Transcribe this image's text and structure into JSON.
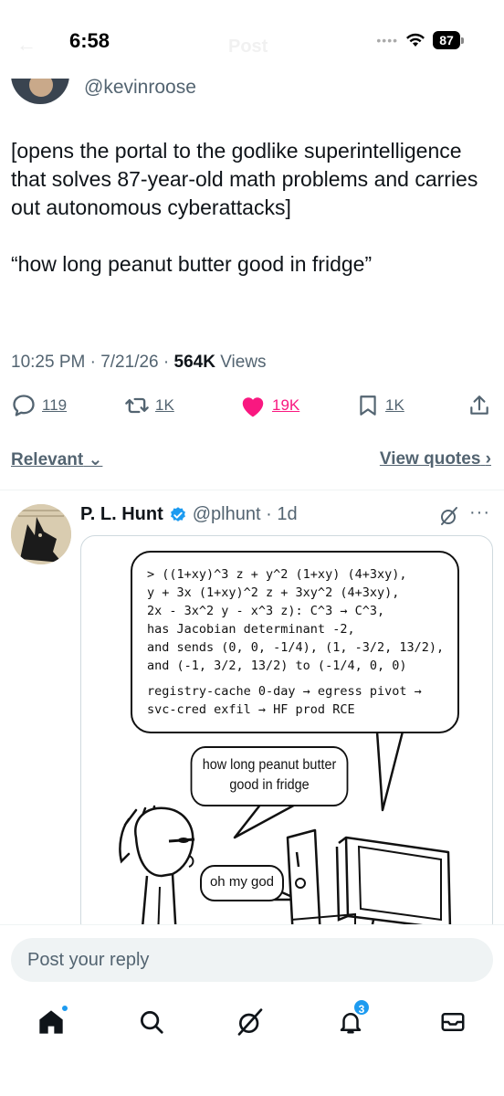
{
  "status_bar": {
    "time": "6:58",
    "battery": "87",
    "signal_dots": "••••"
  },
  "header": {
    "title": "Post"
  },
  "tweet": {
    "handle": "@kevinroose",
    "text_lines": [
      "[opens the portal to the godlike superintelligence that solves 87-year-old math problems and carries out autonomous cyberattacks]",
      "“how long peanut butter good in fridge”"
    ],
    "timestamp": "10:25 PM · 7/21/26 · ",
    "views_count": "564K",
    "views_label": " Views",
    "replies": "119",
    "reposts": "1K",
    "likes": "19K",
    "bookmarks": "1K"
  },
  "filter": {
    "sort_label": "Relevant",
    "view_quotes": "View quotes"
  },
  "reply": {
    "name": "P. L. Hunt",
    "handle_time": "@plhunt · 1d",
    "more": "···",
    "comic": {
      "bubble_lines": [
        "> ((1+xy)^3 z + y^2 (1+xy) (4+3xy),",
        "y + 3x (1+xy)^2 z + 3xy^2 (4+3xy),",
        "2x - 3x^2 y - x^3 z): C^3 → C^3,",
        "has Jacobian determinant -2,",
        "and sends (0, 0, -1/4), (1, -3/2, 13/2),",
        "and (-1, 3/2, 13/2) to (-1/4, 0, 0)"
      ],
      "bubble_lines_2": [
        "registry-cache 0-day → egress pivot →",
        "svc-cred exfil → HF prod RCE"
      ],
      "speech_text": "how long peanut butter good in fridge",
      "reaction_text": "oh my god"
    }
  },
  "composer": {
    "placeholder": "Post your reply"
  },
  "tab_bar": {
    "notifications_badge": "3"
  },
  "colors": {
    "like_pink": "#f91880",
    "accent_blue": "#1d9bf0",
    "secondary_text": "#536471"
  }
}
